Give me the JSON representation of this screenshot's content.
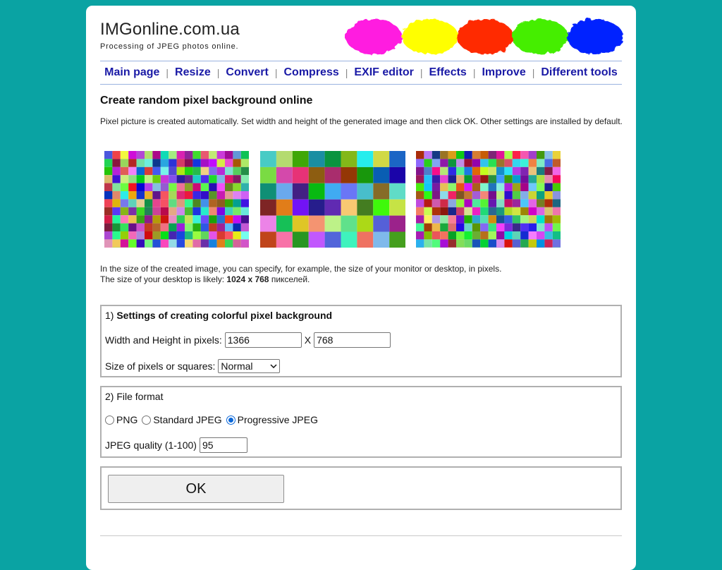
{
  "site": {
    "title": "IMGonline.com.ua",
    "subtitle": "Processing of JPEG photos online.",
    "blob_colors": [
      "#ff1ee0",
      "#ffff00",
      "#ff2a00",
      "#44ee00",
      "#0022ff"
    ]
  },
  "nav": {
    "items": [
      "Main page",
      "Resize",
      "Convert",
      "Compress",
      "EXIF editor",
      "Effects",
      "Improve",
      "Different tools"
    ],
    "link_color": "#1a1aa6"
  },
  "page": {
    "heading": "Create random pixel background online",
    "intro": "Pixel picture is created automatically. Set width and height of the generated image and then click OK. Other settings are installed by default.",
    "desktop_line1": "In the size of the created image, you can specify, for example, the size of your monitor or desktop, in pixels.",
    "desktop_line2_prefix": "The size of your desktop is likely: ",
    "desktop_size": "1024 x 768",
    "desktop_line2_suffix": " пикселей."
  },
  "settings": {
    "title_prefix": "1) ",
    "title_bold": "Settings of creating colorful pixel background",
    "wh_label": "Width and Height in pixels:",
    "width_value": "1366",
    "x_label": "X",
    "height_value": "768",
    "pixel_size_label": "Size of pixels or squares:",
    "pixel_size_value": "Normal"
  },
  "format": {
    "title": "2) File format",
    "options": [
      "PNG",
      "Standard JPEG",
      "Progressive JPEG"
    ],
    "selected": "Progressive JPEG",
    "quality_label": "JPEG quality (1-100)",
    "quality_value": "95"
  },
  "submit": {
    "label": "OK"
  }
}
